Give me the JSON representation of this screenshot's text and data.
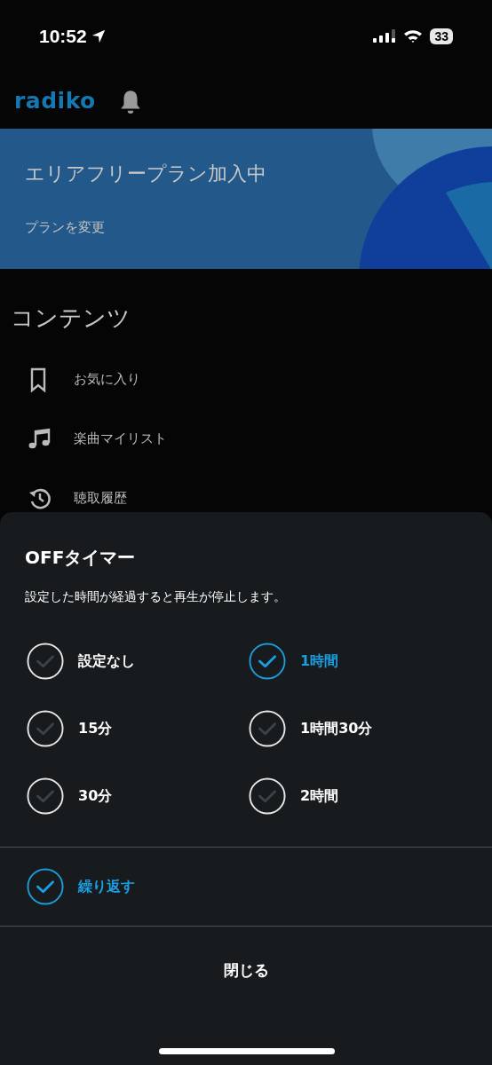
{
  "status_bar": {
    "time": "10:52",
    "battery": "33"
  },
  "header": {
    "logo": "radiko"
  },
  "plan_banner": {
    "title": "エリアフリープラン加入中",
    "link": "プランを変更"
  },
  "contents": {
    "heading": "コンテンツ",
    "items": [
      {
        "kind": "bookmark",
        "label": "お気に入り"
      },
      {
        "kind": "music",
        "label": "楽曲マイリスト"
      },
      {
        "kind": "history",
        "label": "聴取履歴"
      }
    ]
  },
  "timer_sheet": {
    "title": "OFFタイマー",
    "description": "設定した時間が経過すると再生が停止します。",
    "options": [
      {
        "label": "設定なし",
        "selected": false
      },
      {
        "label": "1時間",
        "selected": true
      },
      {
        "label": "15分",
        "selected": false
      },
      {
        "label": "1時間30分",
        "selected": false
      },
      {
        "label": "30分",
        "selected": false
      },
      {
        "label": "2時間",
        "selected": false
      }
    ],
    "repeat": {
      "label": "繰り返す",
      "checked": true
    },
    "close_button": "閉じる"
  }
}
